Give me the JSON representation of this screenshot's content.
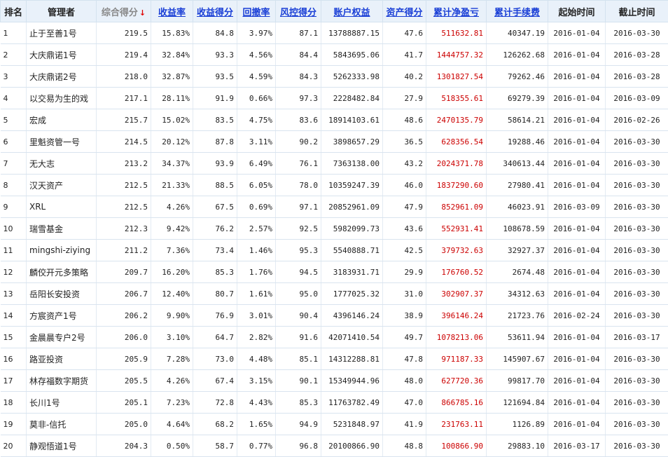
{
  "headers": [
    "排名",
    "管理者",
    "综合得分",
    "收益率",
    "收益得分",
    "回撤率",
    "风控得分",
    "账户权益",
    "资产得分",
    "累计净盈亏",
    "累计手续费",
    "起始时间",
    "截止时间"
  ],
  "sort_arrow": "↓",
  "accent_link_color": "#1a3fd6",
  "profit_color": "#cc0000",
  "rows": [
    [
      "1",
      "止于至善1号",
      "219.5",
      "15.83%",
      "84.8",
      "3.97%",
      "87.1",
      "13788887.15",
      "47.6",
      "511632.81",
      "40347.19",
      "2016-01-04",
      "2016-03-30"
    ],
    [
      "2",
      "大庆鼎诺1号",
      "219.4",
      "32.84%",
      "93.3",
      "4.56%",
      "84.4",
      "5843695.06",
      "41.7",
      "1444757.32",
      "126262.68",
      "2016-01-04",
      "2016-03-28"
    ],
    [
      "3",
      "大庆鼎诺2号",
      "218.0",
      "32.87%",
      "93.5",
      "4.59%",
      "84.3",
      "5262333.98",
      "40.2",
      "1301827.54",
      "79262.46",
      "2016-01-04",
      "2016-03-28"
    ],
    [
      "4",
      "以交易为生的戏",
      "217.1",
      "28.11%",
      "91.9",
      "0.66%",
      "97.3",
      "2228482.84",
      "27.9",
      "518355.61",
      "69279.39",
      "2016-01-04",
      "2016-03-09"
    ],
    [
      "5",
      "宏成",
      "215.7",
      "15.02%",
      "83.5",
      "4.75%",
      "83.6",
      "18914103.61",
      "48.6",
      "2470135.79",
      "58614.21",
      "2016-01-04",
      "2016-02-26"
    ],
    [
      "6",
      "里魁资管一号",
      "214.5",
      "20.12%",
      "87.8",
      "3.11%",
      "90.2",
      "3898657.29",
      "36.5",
      "628356.54",
      "19288.46",
      "2016-01-04",
      "2016-03-30"
    ],
    [
      "7",
      "无大志",
      "213.2",
      "34.37%",
      "93.9",
      "6.49%",
      "76.1",
      "7363138.00",
      "43.2",
      "2024371.78",
      "340613.44",
      "2016-01-04",
      "2016-03-30"
    ],
    [
      "8",
      "汉天资产",
      "212.5",
      "21.33%",
      "88.5",
      "6.05%",
      "78.0",
      "10359247.39",
      "46.0",
      "1837290.60",
      "27980.41",
      "2016-01-04",
      "2016-03-30"
    ],
    [
      "9",
      "XRL",
      "212.5",
      "4.26%",
      "67.5",
      "0.69%",
      "97.1",
      "20852961.09",
      "47.9",
      "852961.09",
      "46023.91",
      "2016-03-09",
      "2016-03-30"
    ],
    [
      "10",
      "瑞雪基金",
      "212.3",
      "9.42%",
      "76.2",
      "2.57%",
      "92.5",
      "5982099.73",
      "43.6",
      "552931.41",
      "108678.59",
      "2016-01-04",
      "2016-03-30"
    ],
    [
      "11",
      "mingshi-ziying",
      "211.2",
      "7.36%",
      "73.4",
      "1.46%",
      "95.3",
      "5540888.71",
      "42.5",
      "379732.63",
      "32927.37",
      "2016-01-04",
      "2016-03-30"
    ],
    [
      "12",
      "麟佼开元多策略",
      "209.7",
      "16.20%",
      "85.3",
      "1.76%",
      "94.5",
      "3183931.71",
      "29.9",
      "176760.52",
      "2674.48",
      "2016-01-04",
      "2016-03-30"
    ],
    [
      "13",
      "岳阳长安投资",
      "206.7",
      "12.40%",
      "80.7",
      "1.61%",
      "95.0",
      "1777025.32",
      "31.0",
      "302907.37",
      "34312.63",
      "2016-01-04",
      "2016-03-30"
    ],
    [
      "14",
      "方宸资产1号",
      "206.2",
      "9.90%",
      "76.9",
      "3.01%",
      "90.4",
      "4396146.24",
      "38.9",
      "396146.24",
      "21723.76",
      "2016-02-24",
      "2016-03-30"
    ],
    [
      "15",
      "金晨晨专户2号",
      "206.0",
      "3.10%",
      "64.7",
      "2.82%",
      "91.6",
      "42071410.54",
      "49.7",
      "1078213.06",
      "53611.94",
      "2016-01-04",
      "2016-03-17"
    ],
    [
      "16",
      "路亚投资",
      "205.9",
      "7.28%",
      "73.0",
      "4.48%",
      "85.1",
      "14312288.81",
      "47.8",
      "971187.33",
      "145907.67",
      "2016-01-04",
      "2016-03-30"
    ],
    [
      "17",
      "林存福数字期货",
      "205.5",
      "4.26%",
      "67.4",
      "3.15%",
      "90.1",
      "15349944.96",
      "48.0",
      "627720.36",
      "99817.70",
      "2016-01-04",
      "2016-03-30"
    ],
    [
      "18",
      "长川1号",
      "205.1",
      "7.23%",
      "72.8",
      "4.43%",
      "85.3",
      "11763782.49",
      "47.0",
      "866785.16",
      "121694.84",
      "2016-01-04",
      "2016-03-30"
    ],
    [
      "19",
      "莫非-信托",
      "205.0",
      "4.64%",
      "68.2",
      "1.65%",
      "94.9",
      "5231848.97",
      "41.9",
      "231763.11",
      "1126.89",
      "2016-01-04",
      "2016-03-30"
    ],
    [
      "20",
      "静观悟道1号",
      "204.3",
      "0.50%",
      "58.7",
      "0.77%",
      "96.8",
      "20100866.90",
      "48.8",
      "100866.90",
      "29883.10",
      "2016-03-17",
      "2016-03-30"
    ]
  ]
}
